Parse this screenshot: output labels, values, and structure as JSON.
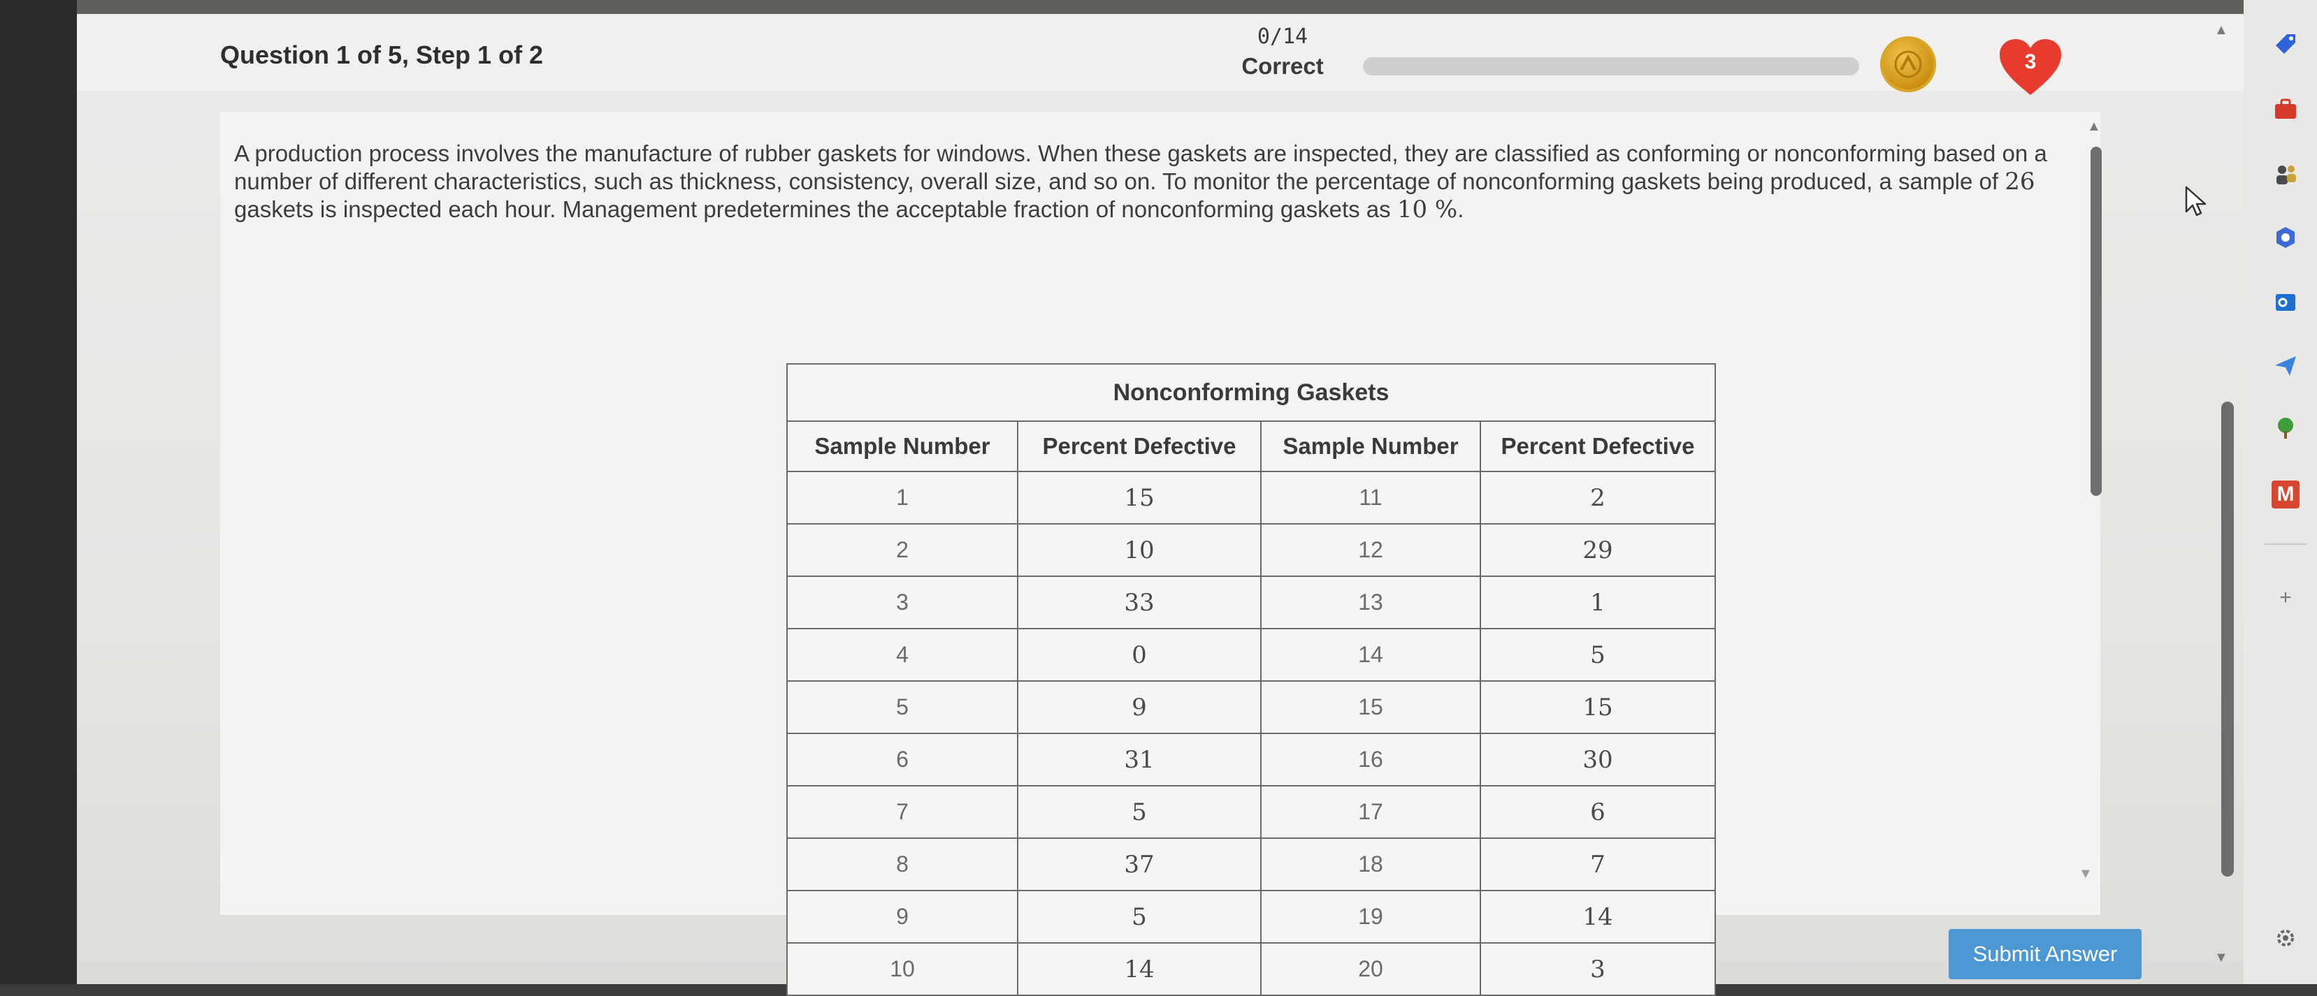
{
  "header": {
    "question_label": "Question 1 of 5, Step 1 of 2",
    "score_value": "0/14",
    "score_label": "Correct",
    "hearts_count": "3"
  },
  "problem": {
    "text_before_sample": "A production process involves the manufacture of rubber gaskets for windows. When these gaskets are inspected, they are classified as conforming or nonconforming based on a number of different characteristics, such as thickness, consistency, overall size, and so on. To monitor the percentage of nonconforming gaskets being produced, a sample of ",
    "sample_size": "26",
    "text_after_sample": " gaskets is inspected each hour. Management predetermines the acceptable fraction of nonconforming gaskets as ",
    "acceptable_fraction": "10 %",
    "text_end": "."
  },
  "table": {
    "caption": "Nonconforming Gaskets",
    "headers": [
      "Sample Number",
      "Percent Defective",
      "Sample Number",
      "Percent Defective"
    ],
    "rows": [
      [
        "1",
        "15",
        "11",
        "2"
      ],
      [
        "2",
        "10",
        "12",
        "29"
      ],
      [
        "3",
        "33",
        "13",
        "1"
      ],
      [
        "4",
        "0",
        "14",
        "5"
      ],
      [
        "5",
        "9",
        "15",
        "15"
      ],
      [
        "6",
        "31",
        "16",
        "30"
      ],
      [
        "7",
        "5",
        "17",
        "6"
      ],
      [
        "8",
        "37",
        "18",
        "7"
      ],
      [
        "9",
        "5",
        "19",
        "14"
      ],
      [
        "10",
        "14",
        "20",
        "3"
      ]
    ]
  },
  "actions": {
    "submit_label": "Submit Answer"
  },
  "side_panel": {
    "icons": [
      "tag-icon",
      "briefcase-icon",
      "people-icon",
      "hexagon-icon",
      "outlook-icon",
      "send-icon",
      "tree-icon",
      "m-icon",
      "plus-icon",
      "settings-icon"
    ],
    "m_letter": "M",
    "plus_symbol": "+"
  },
  "colors": {
    "submit_button": "#4c97d4",
    "heart": "#e63b2e",
    "coin": "#d9a62a"
  }
}
